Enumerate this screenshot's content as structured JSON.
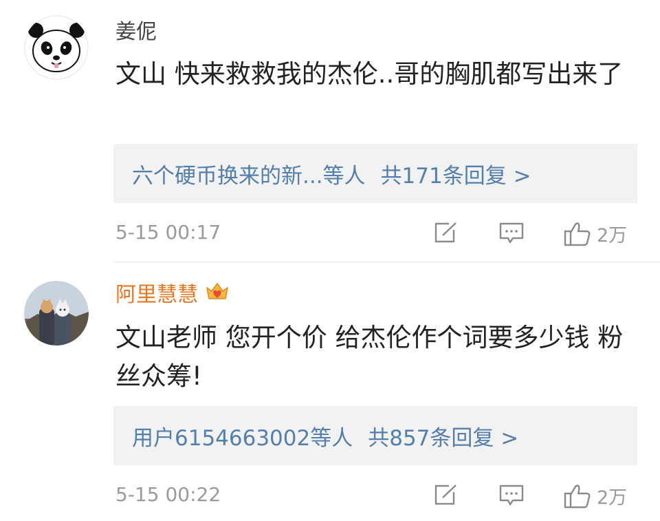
{
  "comments": [
    {
      "username": "姜伲",
      "text": "文山  快来救救我的杰伦..哥的胸肌都写出来了",
      "reply_summary": "六个硬币换来的新...等人",
      "reply_count": "共171条回复 >",
      "time": "5-15 00:17",
      "like_count": "2万"
    },
    {
      "username": "阿里慧慧",
      "text": "文山老师 您开个价 给杰伦作个词要多少钱 粉丝众筹!",
      "reply_summary": "用户6154663002等人",
      "reply_count": "共857条回复 >",
      "time": "5-15 00:22",
      "like_count": "2万"
    }
  ],
  "colors": {
    "vip_name": "#e8761f",
    "link": "#527fad",
    "meta": "#9a9a9a",
    "reply_bg": "#f2f2f2"
  },
  "icons": [
    "panda-avatar",
    "crown-vip-icon",
    "repost-icon",
    "comment-icon",
    "like-icon"
  ]
}
